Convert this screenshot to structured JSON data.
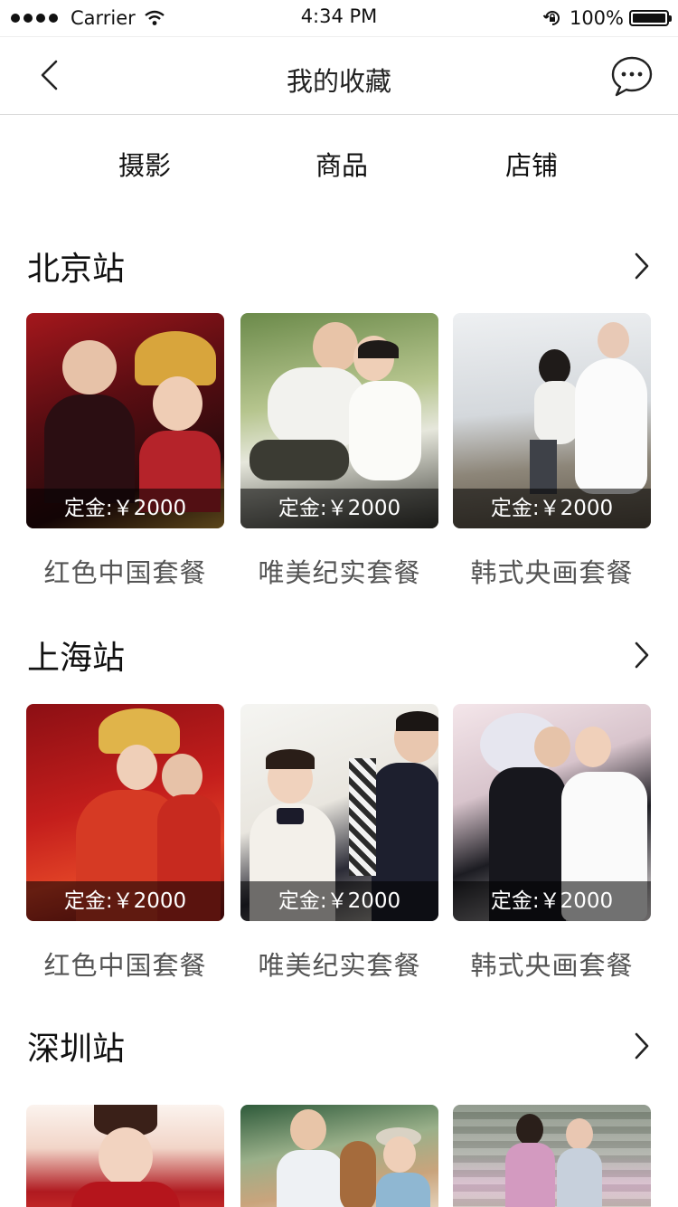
{
  "status_bar": {
    "carrier": "Carrier",
    "time": "4:34 PM",
    "battery": "100%"
  },
  "nav": {
    "title": "我的收藏"
  },
  "tabs": [
    {
      "label": "摄影"
    },
    {
      "label": "商品"
    },
    {
      "label": "店铺"
    }
  ],
  "sections": [
    {
      "title": "北京站",
      "cards": [
        {
          "price": "定金:￥2000",
          "name": "红色中国套餐"
        },
        {
          "price": "定金:￥2000",
          "name": "唯美纪实套餐"
        },
        {
          "price": "定金:￥2000",
          "name": "韩式央画套餐"
        }
      ]
    },
    {
      "title": "上海站",
      "cards": [
        {
          "price": "定金:￥2000",
          "name": "红色中国套餐"
        },
        {
          "price": "定金:￥2000",
          "name": "唯美纪实套餐"
        },
        {
          "price": "定金:￥2000",
          "name": "韩式央画套餐"
        }
      ]
    },
    {
      "title": "深圳站",
      "cards": []
    }
  ],
  "colors": {
    "price_overlay": "#000000",
    "divider": "#d9d9d9"
  }
}
